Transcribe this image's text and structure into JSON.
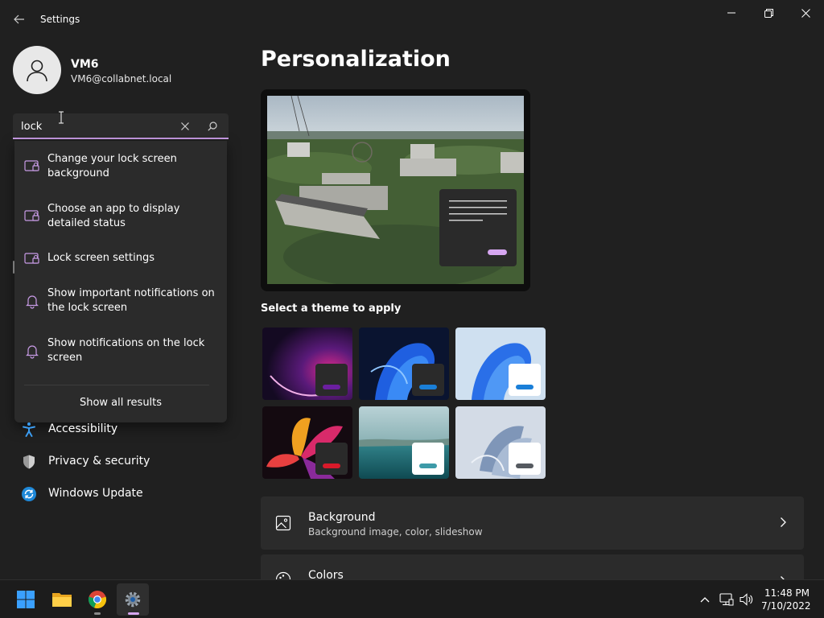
{
  "window": {
    "title": "Settings"
  },
  "profile": {
    "name": "VM6",
    "email": "VM6@collabnet.local"
  },
  "search": {
    "value": "lock",
    "results": [
      {
        "label": "Change your lock screen background",
        "icon": "lock-screen-icon"
      },
      {
        "label": "Choose an app to display detailed status",
        "icon": "lock-screen-icon"
      },
      {
        "label": "Lock screen settings",
        "icon": "lock-screen-icon"
      },
      {
        "label": "Show important notifications on the lock screen",
        "icon": "bell-icon"
      },
      {
        "label": "Show notifications on the lock screen",
        "icon": "bell-icon"
      }
    ],
    "show_all": "Show all results"
  },
  "nav": {
    "items": [
      {
        "label": "Accessibility",
        "icon": "accessibility-icon"
      },
      {
        "label": "Privacy & security",
        "icon": "shield-icon"
      },
      {
        "label": "Windows Update",
        "icon": "windows-update-icon"
      }
    ]
  },
  "main": {
    "title": "Personalization",
    "themes_label": "Select a theme to apply",
    "rows": [
      {
        "title": "Background",
        "subtitle": "Background image, color, slideshow",
        "icon": "image-icon"
      },
      {
        "title": "Colors",
        "subtitle": "",
        "icon": "palette-icon"
      }
    ]
  },
  "taskbar": {
    "apps": [
      "start-icon",
      "file-explorer-icon",
      "chrome-icon",
      "settings-icon"
    ],
    "time": "11:48 PM",
    "date": "7/10/2022"
  },
  "colors": {
    "accent": "#c89be6",
    "background": "#202020",
    "card": "#2b2b2b"
  }
}
